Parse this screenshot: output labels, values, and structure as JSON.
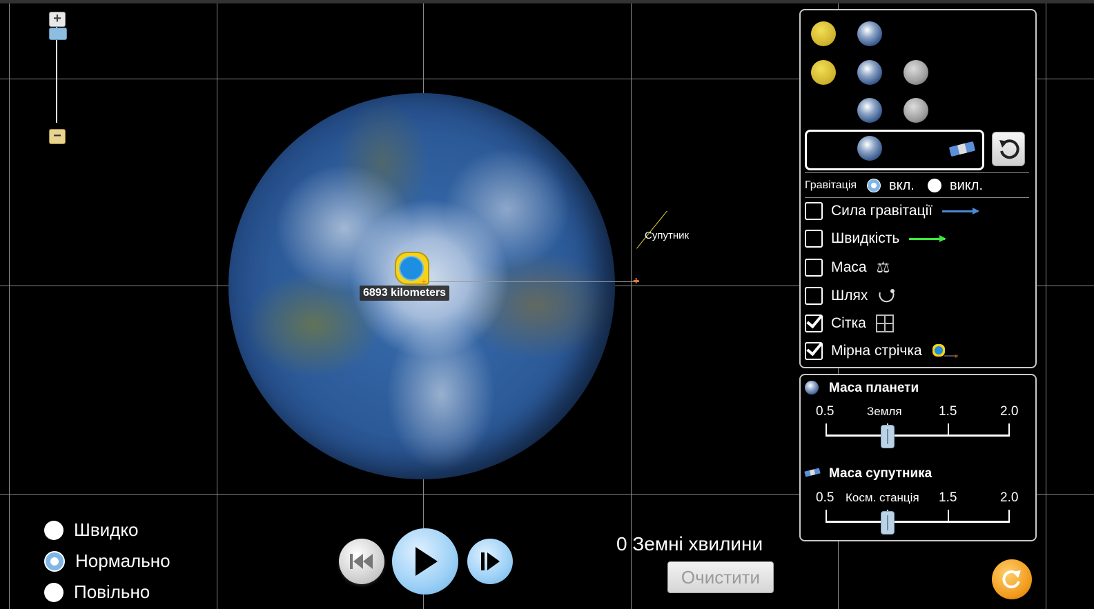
{
  "zoom": {
    "plus": "+",
    "minus": "−",
    "level": 0.95
  },
  "scene": {
    "satellite_label": "Супутник",
    "tape_reading": "6893 kilometers"
  },
  "speed": {
    "options": [
      "Швидко",
      "Нормально",
      "Повільно"
    ],
    "selected": "Нормально"
  },
  "playback": {
    "rewind_icon": "rewind-icon",
    "play_icon": "play-icon",
    "step_icon": "step-forward-icon"
  },
  "time": {
    "readout": "0 Земні хвилини"
  },
  "clear_button": "Очистити",
  "controls": {
    "presets": [
      [
        "sun",
        "earth"
      ],
      [
        "sun",
        "earth",
        "moon"
      ],
      [
        "earth",
        "moon"
      ],
      [
        "earth",
        "satellite"
      ]
    ],
    "selected_preset": 3,
    "gravity_label": "Гравітація",
    "gravity_on": "вкл.",
    "gravity_off": "викл.",
    "gravity_selected": "вкл.",
    "checkboxes": [
      {
        "label": "Сила гравітації",
        "checked": false,
        "icon": "blue-arrow-icon"
      },
      {
        "label": "Швидкість",
        "checked": false,
        "icon": "green-arrow-icon"
      },
      {
        "label": "Маса",
        "checked": false,
        "icon": "balance-scale-icon"
      },
      {
        "label": "Шлях",
        "checked": false,
        "icon": "path-icon"
      },
      {
        "label": "Сітка",
        "checked": true,
        "icon": "grid-icon"
      },
      {
        "label": "Мірна стрічка",
        "checked": true,
        "icon": "measuring-tape-icon"
      }
    ]
  },
  "sliders": {
    "planet": {
      "title": "Маса планети",
      "ticks": [
        "0.5",
        "Земля",
        "1.5",
        "2.0"
      ],
      "value": 1.0,
      "min": 0.5,
      "max": 2.0
    },
    "satellite": {
      "title": "Маса супутника",
      "ticks": [
        "0.5",
        "Косм. станція",
        "1.5",
        "2.0"
      ],
      "value": 1.0,
      "min": 0.5,
      "max": 2.0
    }
  },
  "colors": {
    "background": "#000000",
    "gravity_arrow": "#4a8ad6",
    "velocity_arrow": "#3ce83c",
    "tape": "#f6d31a",
    "reset_all": "#f19a1c",
    "play_button": "#9cd0f6"
  }
}
